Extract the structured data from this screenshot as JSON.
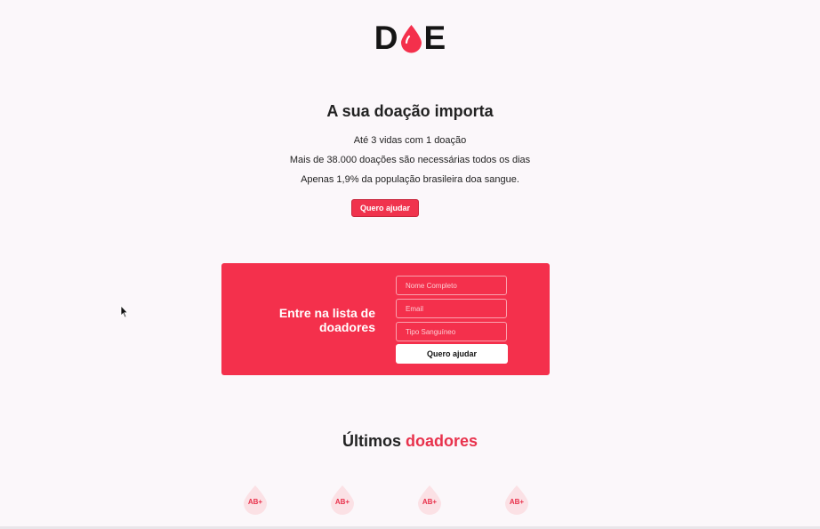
{
  "brand": {
    "logo_left": "D",
    "logo_right": "E",
    "accent_color": "#f4304c"
  },
  "hero": {
    "title": "A sua doação importa",
    "lines": [
      "Até 3 vidas com 1 doação",
      "Mais de 38.000 doações são necessárias todos os dias",
      "Apenas 1,9% da população brasileira doa sangue."
    ],
    "button_label": "Quero ajudar"
  },
  "form": {
    "heading": "Entre na lista de doadores",
    "name_placeholder": "Nome Completo",
    "email_placeholder": "Email",
    "blood_placeholder": "Tipo Sanguíneo",
    "submit_label": "Quero ajudar"
  },
  "latest": {
    "title_prefix": "Últimos",
    "title_accent": "doadores",
    "donors": [
      {
        "blood_type": "AB+"
      },
      {
        "blood_type": "AB+"
      },
      {
        "blood_type": "AB+"
      },
      {
        "blood_type": "AB+"
      }
    ]
  }
}
